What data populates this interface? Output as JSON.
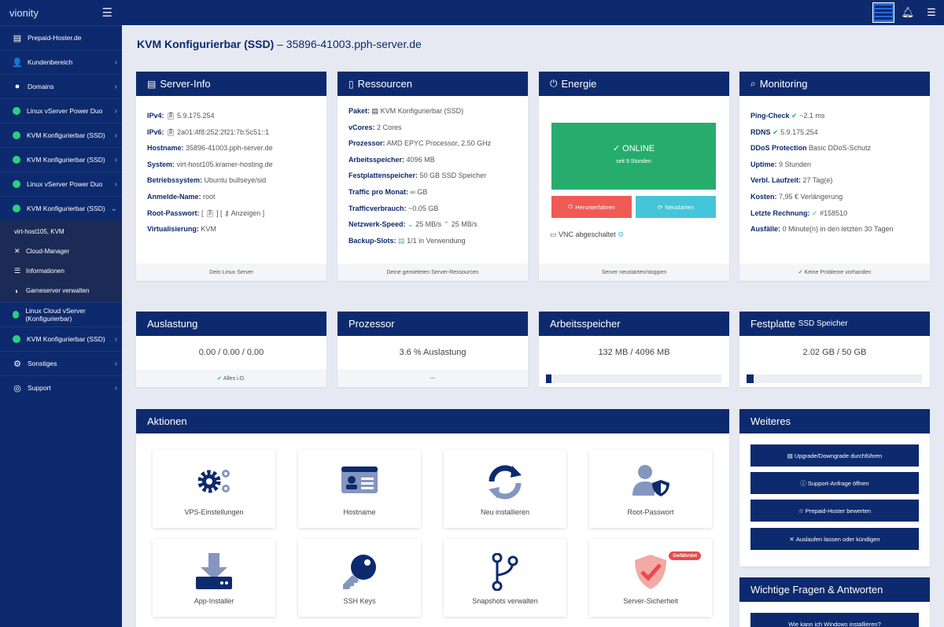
{
  "app": {
    "brand": "vionity"
  },
  "sidebar": {
    "items": [
      {
        "label": "Prepaid-Hoster.de"
      },
      {
        "label": "Kundenbereich"
      },
      {
        "label": "Domains"
      },
      {
        "label": "Linux vServer Power Duo"
      },
      {
        "label": "KVM Konfigurierbar (SSD)"
      },
      {
        "label": "KVM Konfigurierbar (SSD)"
      },
      {
        "label": "Linux vServer Power Duo"
      },
      {
        "label": "KVM Konfigurierbar (SSD)"
      }
    ],
    "sub": {
      "host": "virt-host105, KVM",
      "items": [
        {
          "label": "Cloud-Manager"
        },
        {
          "label": "Informationen"
        },
        {
          "label": "Gameserver verwalten"
        }
      ]
    },
    "after": [
      {
        "label": "Linux Cloud vServer (Konfigurierbar)"
      },
      {
        "label": "KVM Konfigurierbar (SSD)"
      },
      {
        "label": "Sonstiges"
      },
      {
        "label": "Support"
      }
    ]
  },
  "page": {
    "title": "KVM Konfigurierbar (SSD)",
    "subtitle": "– 35896-41003.pph-server.de"
  },
  "serverinfo": {
    "title": "Server-Info",
    "ipv4_label": "IPv4:",
    "ipv4": "5.9.175.254",
    "ipv6_label": "IPv6:",
    "ipv6": "2a01:4f8:252:2f21:7b:5c51::1",
    "hostname_label": "Hostname:",
    "hostname": "35896-41003.pph-server.de",
    "system_label": "System:",
    "system": "virt-host105.kramer-hosting.de",
    "os_label": "Betriebssystem:",
    "os": "Ubuntu bullseye/sid",
    "login_label": "Anmelde-Name:",
    "login": "root",
    "pw_label": "Root-Passwort:",
    "pw_show": "Anzeigen",
    "virt_label": "Virtualisierung:",
    "virt": "KVM",
    "footer": "Dein Linux Server"
  },
  "resources": {
    "title": "Ressourcen",
    "paket_label": "Paket:",
    "paket": "KVM Konfigurierbar (SSD)",
    "vcores_label": "vCores:",
    "vcores": "2 Cores",
    "cpu_label": "Prozessor:",
    "cpu": "AMD EPYC Processor, 2.50 GHz",
    "ram_label": "Arbeitsspeicher:",
    "ram": "4096 MB",
    "disk_label": "Festplattenspeicher:",
    "disk": "50 GB SSD Speicher",
    "traffic_label": "Traffic pro Monat:",
    "traffic": "∞ GB",
    "usage_label": "Trafficverbrauch:",
    "usage": "~0.05 GB",
    "net_label": "Netzwerk-Speed:",
    "net_down": "25 MB/s",
    "net_up": "25 MB/s",
    "backup_label": "Backup-Slots:",
    "backup": "1/1 in Verwendung",
    "footer": "Deine gemieteten Server-Ressourcen"
  },
  "energy": {
    "title": "Energie",
    "status": "ONLINE",
    "since": "seit 9 Stunden",
    "shutdown": "Herunterfahren",
    "restart": "Neustarten",
    "vnc": "VNC abgeschaltet",
    "footer": "Server neustarten/stoppen"
  },
  "monitoring": {
    "title": "Monitoring",
    "ping_label": "Ping-Check",
    "ping": "~2.1 ms",
    "rdns_label": "RDNS",
    "rdns": "5.9.175.254",
    "ddos_label": "DDoS Protection",
    "ddos": "Basic DDoS-Schutz",
    "uptime_label": "Uptime:",
    "uptime": "9 Stunden",
    "remaining_label": "Verbl. Laufzeit:",
    "remaining": "27 Tag(e)",
    "cost_label": "Kosten:",
    "cost": "7,95 € Verlängerung",
    "invoice_label": "Letzte Rechnung:",
    "invoice": "#158510",
    "outage_label": "Ausfälle:",
    "outage": "0 Minute(n) in den letzten 30 Tagen",
    "footer": "Keine Probleme vorhanden"
  },
  "load": {
    "title": "Auslastung",
    "value": "0.00 / 0.00 / 0.00",
    "footer": "Alles i.O."
  },
  "processor": {
    "title": "Prozessor",
    "value": "3.6 % Auslastung",
    "footer": "---"
  },
  "memory": {
    "title": "Arbeitsspeicher",
    "value": "132 MB / 4096 MB",
    "fraction": 0.032
  },
  "storage": {
    "title": "Festplatte",
    "subtitle": "SSD Speicher",
    "value": "2.02 GB / 50 GB",
    "fraction": 0.04
  },
  "actions": {
    "title": "Aktionen",
    "tiles": [
      {
        "label": "VPS-Einstellungen"
      },
      {
        "label": "Hostname"
      },
      {
        "label": "Neu installieren"
      },
      {
        "label": "Root-Passwort"
      },
      {
        "label": "App-Installer"
      },
      {
        "label": "SSH Keys"
      },
      {
        "label": "Snapshots verwalten"
      },
      {
        "label": "Server-Sicherheit",
        "badge": "Gefährdet"
      }
    ]
  },
  "more": {
    "title": "Weiteres",
    "buttons": [
      {
        "label": "Upgrade/Downgrade durchführen"
      },
      {
        "label": "Support-Anfrage öffnen"
      },
      {
        "label": "Prepaid-Hoster bewerten"
      },
      {
        "label": "Auslaufen lassen oder kündigen"
      }
    ]
  },
  "faq": {
    "title": "Wichtige Fragen & Antworten",
    "first": "Wie kann ich Windows installieren?"
  },
  "colors": {
    "navy": "#0d2a6e",
    "online": "#26ad6d",
    "danger": "#f05a55",
    "teal": "#45c5da",
    "green": "#2bd07d"
  }
}
